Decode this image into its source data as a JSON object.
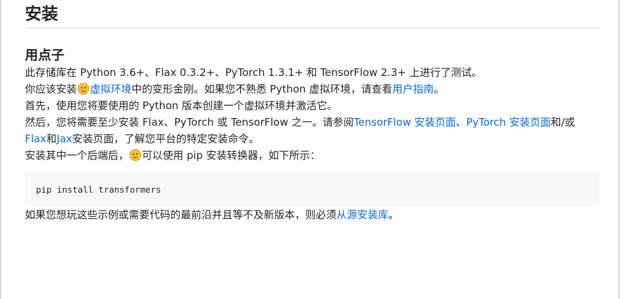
{
  "heading": "安装",
  "subheading": "用点子",
  "paragraphs": {
    "tested": "此存储库在 Python 3.6+、Flax 0.3.2+、PyTorch 1.3.1+ 和 TensorFlow 2.3+ 上进行了测试。",
    "venv": {
      "before": "你应该安装",
      "link_venv": "虚拟环境",
      "middle": "中的变形金刚。如果您不熟悉 Python 虚拟环境，请查看",
      "link_guide": "用户指南",
      "after": "。"
    },
    "first": "首先，使用您将要使用的 Python 版本创建一个虚拟环境并激活它。",
    "then": {
      "before": "然后，您将需要至少安装 Flax、PyTorch 或 TensorFlow 之一。请参阅",
      "link_tf": "TensorFlow 安装页面",
      "sep": "、",
      "link_pt": "PyTorch 安装页面",
      "mid": "和/或",
      "link_flax": "Flax",
      "and": "和",
      "link_jax": "Jax",
      "after": "安装页面，了解您平台的特定安装命令。"
    },
    "backend": {
      "before": "安装其中一个后端后，",
      "after": "可以使用 pip 安装转换器，如下所示："
    },
    "source": {
      "before": "如果您想玩这些示例或需要代码的最前沿并且等不及新版本，则必须",
      "link_source": "从源安装库",
      "after": "。"
    }
  },
  "code": "pip install transformers",
  "icons": {
    "emoji": "hugging-face-emoji-icon"
  },
  "colors": {
    "link": "#0969da",
    "text": "#1f2328",
    "code_bg": "#f6f8fa"
  }
}
